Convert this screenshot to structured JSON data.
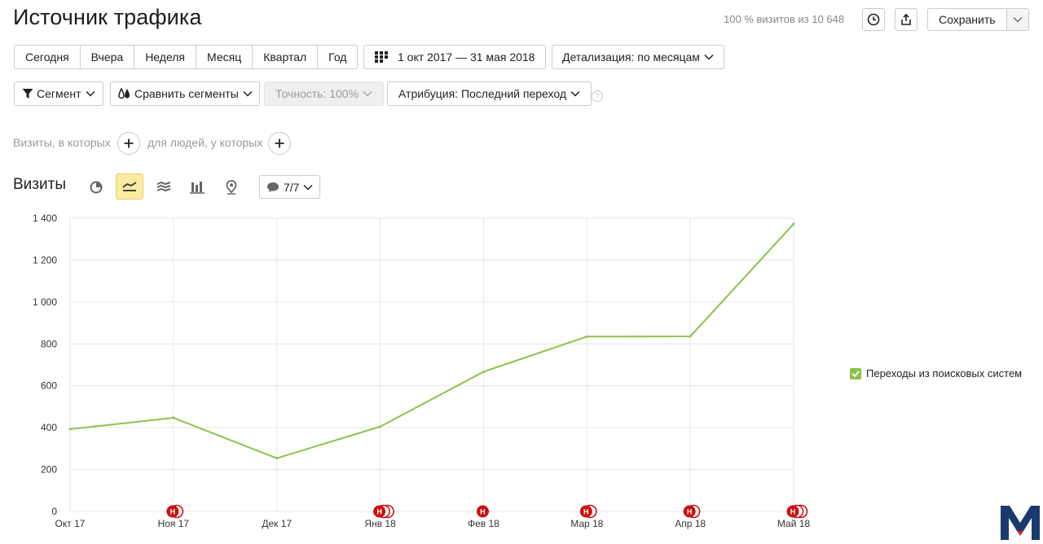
{
  "header": {
    "title": "Источник трафика",
    "visits_share": "100 % визитов из 10 648",
    "save_label": "Сохранить"
  },
  "periods": [
    "Сегодня",
    "Вчера",
    "Неделя",
    "Месяц",
    "Квартал",
    "Год"
  ],
  "date_range": "1 окт 2017 — 31 мая 2018",
  "detail": "Детализация: по месяцам",
  "segment": "Сегмент",
  "compare": "Сравнить сегменты",
  "accuracy": "Точность: 100%",
  "attribution": "Атрибуция: Последний переход",
  "hint": "?",
  "filters": {
    "visits_label": "Визиты, в которых",
    "people_label": "для людей, у которых"
  },
  "chart_section": {
    "title": "Визиты",
    "annotations_count": "7/7",
    "views": [
      "pie-chart-icon",
      "line-chart-icon",
      "stacked-area-icon",
      "bar-chart-icon",
      "map-pin-icon"
    ]
  },
  "chart_data": {
    "type": "line",
    "categories": [
      "Окт 17",
      "Ноя 17",
      "Дек 17",
      "Янв 18",
      "Фев 18",
      "Мар 18",
      "Апр 18",
      "Май 18"
    ],
    "series": [
      {
        "name": "Переходы из поисковых систем",
        "color": "#8bc34a",
        "values": [
          393,
          447,
          254,
          405,
          667,
          835,
          836,
          1373
        ]
      }
    ],
    "ylim": [
      0,
      1400
    ],
    "yticks": [
      0,
      200,
      400,
      600,
      800,
      1000,
      1200,
      1400
    ],
    "ytick_labels": [
      "0",
      "200",
      "400",
      "600",
      "800",
      "1 000",
      "1 200",
      "1 400"
    ],
    "grid": true,
    "legend": "right",
    "markers": [
      {
        "category": "Ноя 17",
        "count": 2,
        "label": "Н"
      },
      {
        "category": "Янв 18",
        "count": 3,
        "label": "Н"
      },
      {
        "category": "Фев 18",
        "count": 1,
        "label": "Н"
      },
      {
        "category": "Мар 18",
        "count": 2,
        "label": "Н"
      },
      {
        "category": "Апр 18",
        "count": 2,
        "label": "Н"
      },
      {
        "category": "Май 18",
        "count": 3,
        "label": "Н"
      }
    ],
    "marker_color": "#cc1111"
  }
}
